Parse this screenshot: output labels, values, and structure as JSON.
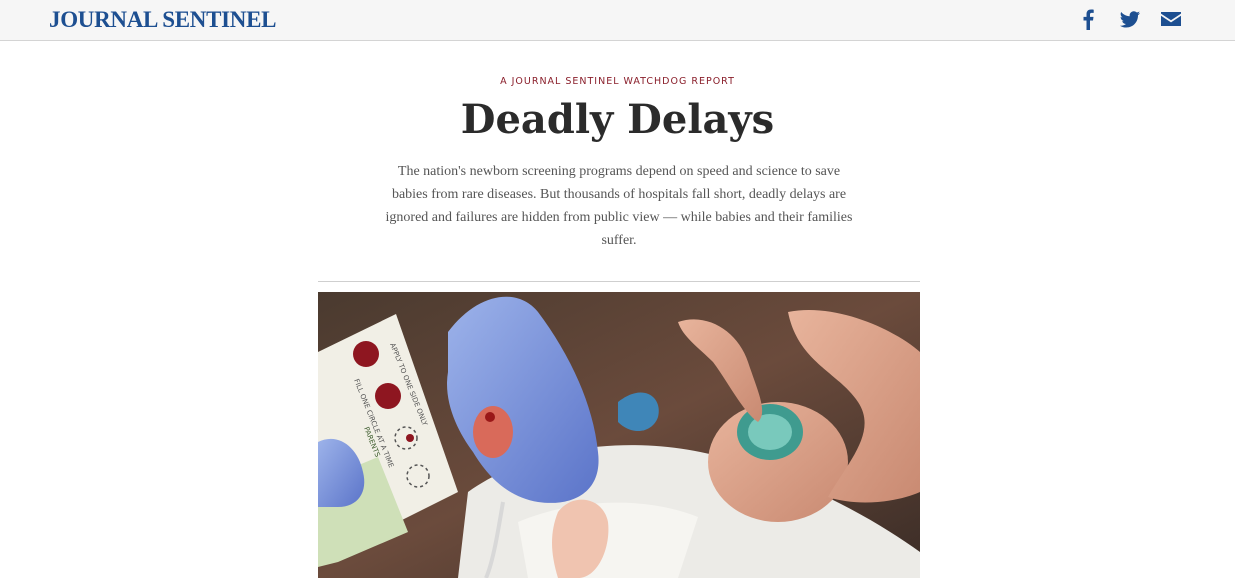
{
  "header": {
    "logo": "JOURNAL SENTINEL",
    "social": [
      {
        "icon": "facebook-icon"
      },
      {
        "icon": "twitter-icon"
      },
      {
        "icon": "email-icon"
      }
    ],
    "brand_color": "#1d4f91"
  },
  "article": {
    "kicker": "A JOURNAL SENTINEL WATCHDOG REPORT",
    "kicker_color": "#8a1f2b",
    "headline": "Deadly Delays",
    "dek": "The nation's newborn screening programs depend on speed and science to save babies from rare diseases. But thousands of hospitals fall short, deadly delays are ignored and failures are hidden from public view — while babies and their families suffer.",
    "photo": {
      "card_text_1": "APPLY TO ONE SIDE ONLY",
      "card_text_2": "FILL ONE CIRCLE AT A TIME",
      "card_text_3": "PARENTS"
    }
  }
}
